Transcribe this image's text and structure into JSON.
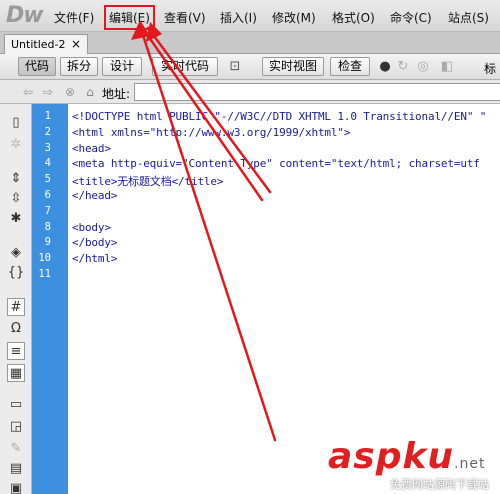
{
  "app": {
    "logo": "Dw"
  },
  "menu": [
    "文件(F)",
    "编辑(E)",
    "查看(V)",
    "插入(I)",
    "修改(M)",
    "格式(O)",
    "命令(C)",
    "站点(S)"
  ],
  "tab": {
    "title": "Untitled-2",
    "close": "×"
  },
  "toolbar": {
    "code": "代码",
    "split": "拆分",
    "design": "设计",
    "live_code": "实时代码",
    "live_view": "实时视图",
    "inspect": "检查",
    "title_label": "标"
  },
  "address": {
    "label": "地址:",
    "value": ""
  },
  "editor": {
    "line_numbers": [
      "1",
      "2",
      "3",
      "4",
      "5",
      "6",
      "7",
      "8",
      "9",
      "10",
      "11"
    ],
    "lines": [
      "<!DOCTYPE html PUBLIC \"-//W3C//DTD XHTML 1.0 Transitional//EN\" \"",
      "<html xmlns=\"http://www.w3.org/1999/xhtml\">",
      "<head>",
      "<meta http-equiv=\"Content-Type\" content=\"text/html; charset=utf",
      "<title>无标题文档</title>",
      "</head>",
      "",
      "<body>",
      "</body>",
      "</html>",
      ""
    ]
  },
  "watermark": {
    "brand": "aspku",
    "domain": ".net",
    "tagline": "免费网站源码下载站"
  },
  "colors": {
    "highlight": "#e0191e",
    "gutter": "#3d8fe0",
    "code": "#1a1a9a"
  }
}
